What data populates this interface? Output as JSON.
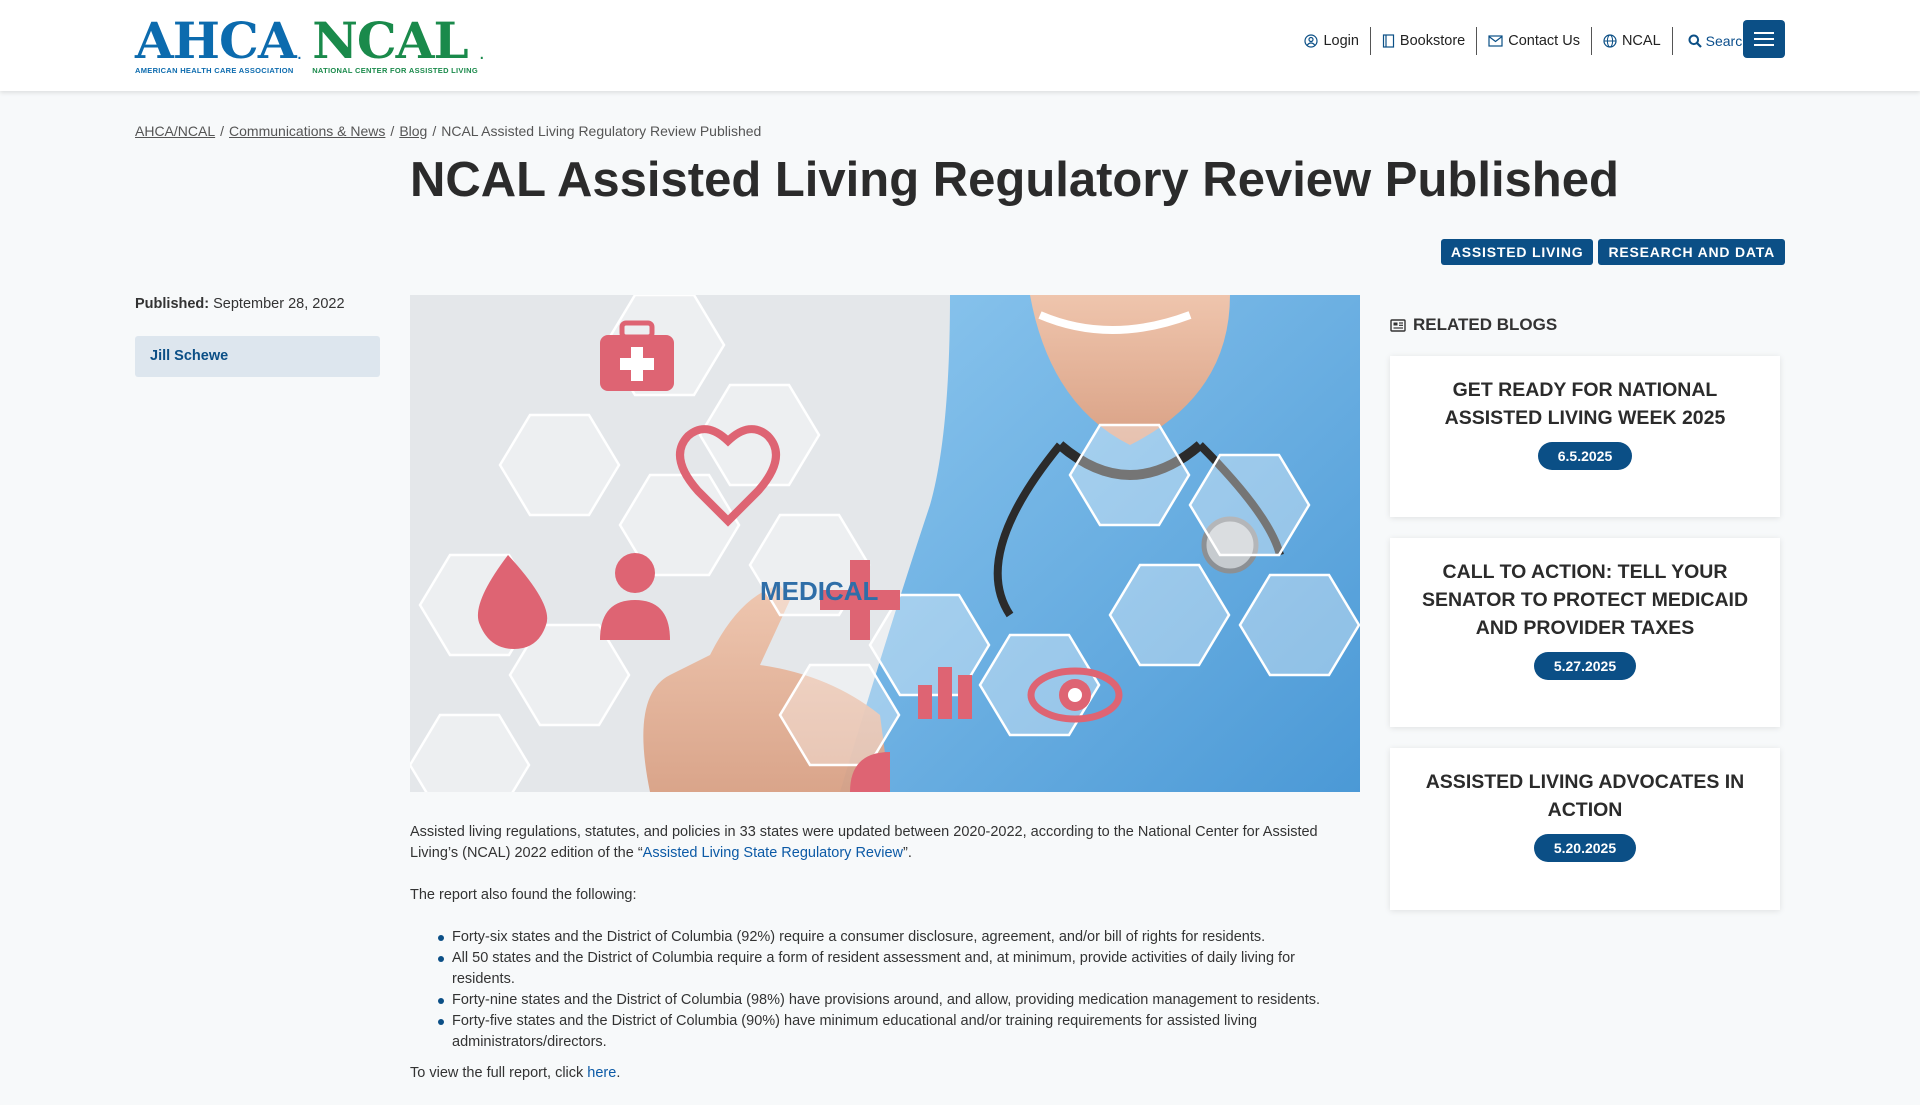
{
  "header": {
    "logo_ahca": "AHCA",
    "logo_ahca_sub": "AMERICAN HEALTH CARE ASSOCIATION",
    "logo_ncal": "NCAL",
    "logo_ncal_sub": "NATIONAL CENTER FOR ASSISTED LIVING",
    "nav": [
      {
        "label": "Login",
        "icon": "user-circle-icon"
      },
      {
        "label": "Bookstore",
        "icon": "book-icon"
      },
      {
        "label": "Contact Us",
        "icon": "envelope-icon"
      },
      {
        "label": "NCAL",
        "icon": "globe-icon"
      }
    ],
    "search_label": "Search",
    "accent": "#0b4f86"
  },
  "breadcrumb": {
    "items": [
      "AHCA/NCAL",
      "Communications & News",
      "Blog"
    ],
    "current": "NCAL Assisted Living Regulatory Review Published"
  },
  "page": {
    "title": "NCAL Assisted Living Regulatory Review Published",
    "tags": [
      "Assisted Living",
      "Research and Data"
    ],
    "published_label": "Published:",
    "published_date": "September 28, 2022",
    "author": "Jill Schewe"
  },
  "hero": {
    "center_label": "MEDICAL"
  },
  "article": {
    "p1_before": "Assisted living regulations, statutes, and policies in 33 states were updated between 2020-2022, according to the National Center for Assisted Living’s (NCAL) 2022 edition of the “",
    "p1_link": "Assisted Living State Regulatory Review",
    "p1_after": "”.",
    "p2": "The report also found the following:",
    "bullets": [
      "Forty-six states and the District of Columbia (92%) require a consumer disclosure, agreement, and/or bill of rights for residents.",
      "All 50 states and the District of Columbia require a form of resident assessment and, at minimum, provide activities of daily living for residents.",
      "Forty-nine states and the District of Columbia (98%) have provisions around, and allow, providing medication management to residents.",
      "Forty-five states and the District of Columbia (90%) have minimum educational and/or training requirements for assisted living administrators/directors."
    ],
    "p3_before": "To view the full report, click ",
    "p3_link": "here",
    "p3_after": "."
  },
  "sidebar": {
    "heading": "RELATED BLOGS",
    "cards": [
      {
        "title": "Get Ready for National Assisted Living Week 2025",
        "date": "6.5.2025"
      },
      {
        "title": "Call to Action: Tell Your Senator to Protect Medicaid and Provider Taxes",
        "date": "5.27.2025"
      },
      {
        "title": "Assisted Living Advocates in Action",
        "date": "5.20.2025"
      }
    ]
  }
}
